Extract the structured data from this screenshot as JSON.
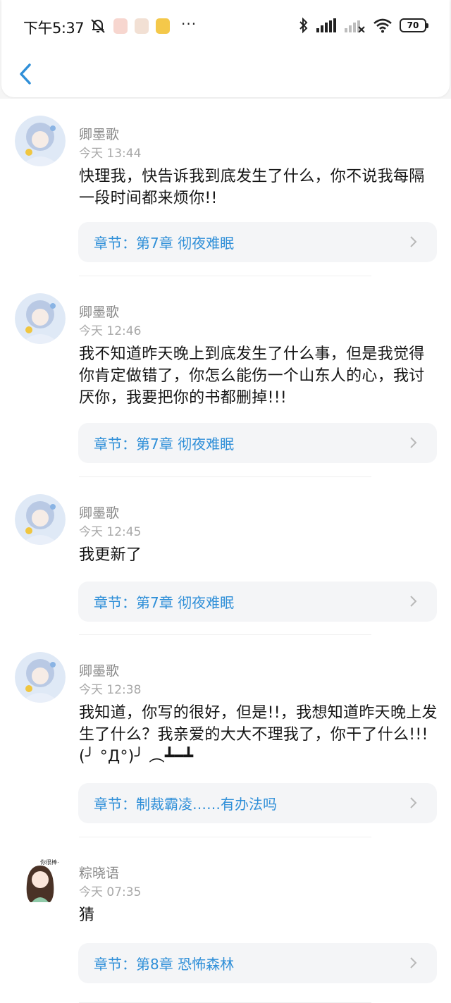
{
  "status_bar": {
    "time": "下午5:37",
    "battery": "70",
    "more": "···"
  },
  "nav": {
    "back_icon": "chevron-left-icon"
  },
  "comments": [
    {
      "name": "卿墨歌",
      "time": "今天 13:44",
      "text": "快理我，快告诉我到底发生了什么，你不说我每隔一段时间都来烦你!!",
      "chapter": "章节：第7章 彻夜难眠"
    },
    {
      "name": "卿墨歌",
      "time": "今天 12:46",
      "text": "我不知道昨天晚上到底发生了什么事，但是我觉得你肯定做错了，你怎么能伤一个山东人的心，我讨厌你，我要把你的书都删掉!!!",
      "chapter": "章节：第7章 彻夜难眠"
    },
    {
      "name": "卿墨歌",
      "time": "今天 12:45",
      "text": "我更新了",
      "chapter": "章节：第7章 彻夜难眠"
    },
    {
      "name": "卿墨歌",
      "time": "今天 12:38",
      "text": "我知道，你写的很好，但是!!，我想知道昨天晚上发生了什么？我亲爱的大大不理我了，你干了什么!!! (╯ °Д°)╯ ︵┻━┻",
      "chapter": "章节：制裁霸凌……有办法吗"
    },
    {
      "name": "粽晓语",
      "time": "今天 07:35",
      "text": "猜",
      "chapter": "章节：第8章 恐怖森林",
      "avatar_caption": "你很棒~"
    }
  ],
  "colors": {
    "accent": "#2f8fd8",
    "chapter_bg": "#f4f5f7",
    "page_bg": "#f5f5f5"
  }
}
